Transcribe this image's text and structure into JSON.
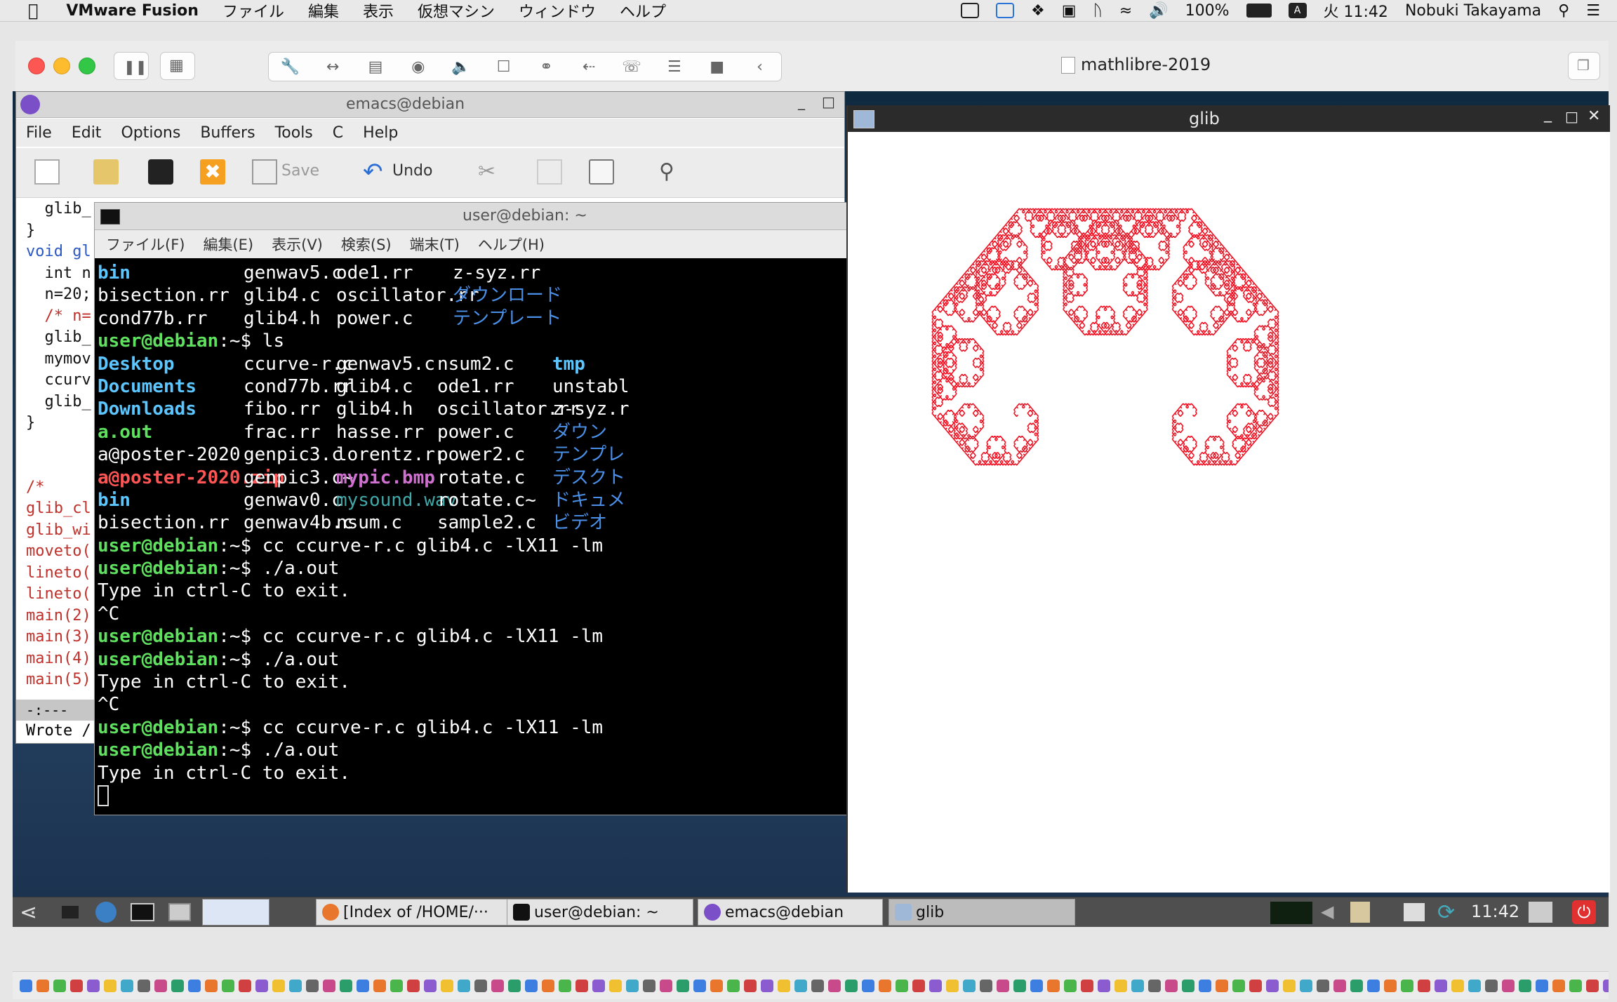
{
  "mac_menubar": {
    "app_name": "VMware Fusion",
    "menus": [
      "ファイル",
      "編集",
      "表示",
      "仮想マシン",
      "ウィンドウ",
      "ヘルプ"
    ],
    "battery": "100%",
    "input_mode": "A",
    "clock": "火 11:42",
    "user": "Nobuki Takayama"
  },
  "fusion": {
    "vm_title": "mathlibre-2019"
  },
  "emacs": {
    "window_title": "emacs@debian",
    "menus": [
      "File",
      "Edit",
      "Options",
      "Buffers",
      "Tools",
      "C",
      "Help"
    ],
    "toolbar": {
      "save_label": "Save",
      "undo_label": "Undo"
    },
    "code_lines": [
      "  glib_",
      "}",
      "void gl",
      "  int n",
      "  n=20;",
      "  /* n=",
      "  glib_",
      "  mymov",
      "  ccurv",
      "  glib_",
      "}",
      "",
      "",
      "/*",
      "glib_cl",
      "glib_wi",
      "moveto(",
      "lineto(",
      "lineto(",
      "main(2)",
      "main(3)",
      "main(4)",
      "main(5)"
    ],
    "modeline": "-:---",
    "echo_area": "Wrote /"
  },
  "terminal": {
    "window_title": "user@debian: ~",
    "menus": [
      "ファイル(F)",
      "編集(E)",
      "表示(V)",
      "検索(S)",
      "端末(T)",
      "ヘルプ(H)"
    ],
    "prompt": "user@debian",
    "prompt_suffix": ":~$",
    "listing_top": [
      [
        "bin",
        "genwav5.c",
        "ode1.rr",
        "z-syz.rr"
      ],
      [
        "bisection.rr",
        "glib4.c",
        "oscillator.rr",
        "ダウンロード"
      ],
      [
        "cond77b.rr",
        "glib4.h",
        "power.c",
        "テンプレート"
      ]
    ],
    "cmd_ls": "ls",
    "listing_ls": [
      [
        "Desktop",
        "ccurve-r.c",
        "genwav5.c",
        "nsum2.c",
        "tmp"
      ],
      [
        "Documents",
        "cond77b.rr",
        "glib4.c",
        "ode1.rr",
        "unstabl"
      ],
      [
        "Downloads",
        "fibo.rr",
        "glib4.h",
        "oscillator.rr",
        "z-syz.r"
      ],
      [
        "a.out",
        "frac.rr",
        "hasse.rr",
        "power.c",
        "ダウン"
      ],
      [
        "a@poster-2020",
        "genpic3.c",
        "lorentz.rr",
        "power2.c",
        "テンプレ"
      ],
      [
        "a@poster-2020.zip",
        "genpic3.c~",
        "mypic.bmp",
        "rotate.c",
        "デスクト"
      ],
      [
        "bin",
        "genwav0.c",
        "mysound.wav",
        "rotate.c~",
        "ドキュメ"
      ],
      [
        "bisection.rr",
        "genwav4b.c",
        "nsum.c",
        "sample2.c",
        "ビデオ"
      ]
    ],
    "cmd_compile": "cc ccurve-r.c glib4.c -lX11 -lm",
    "cmd_run": "./a.out",
    "msg_exit": "Type in ctrl-C to exit.",
    "ctrl_c": "^C"
  },
  "glib": {
    "window_title": "glib",
    "fractal_color": "#ee1122"
  },
  "panel": {
    "tasks": [
      "[Index of /HOME/···",
      "user@debian: ~",
      "emacs@debian",
      "glib"
    ],
    "clock": "11:42"
  }
}
